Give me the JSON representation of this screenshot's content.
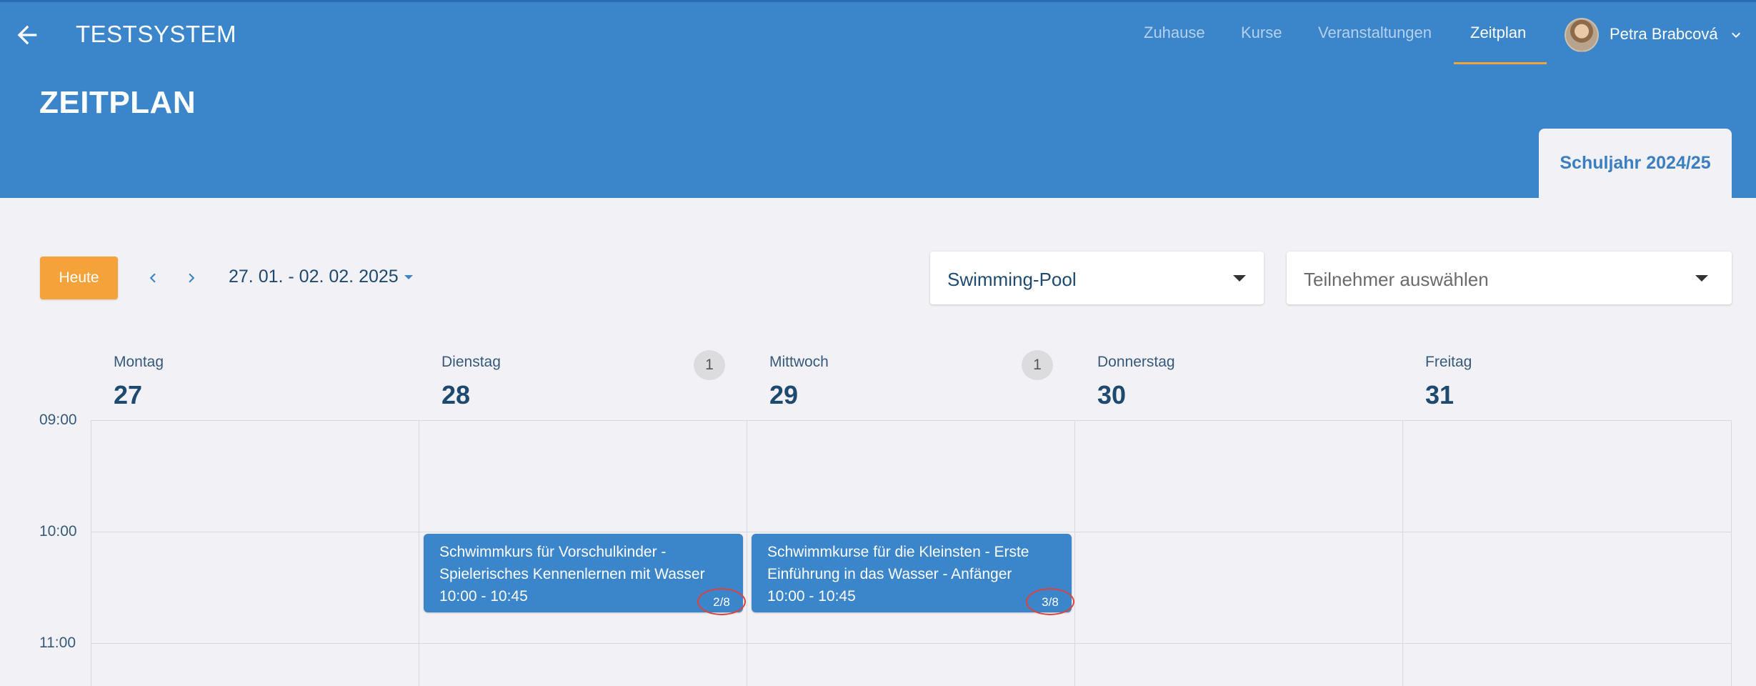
{
  "appbar": {
    "title": "TESTSYSTEM",
    "nav": [
      {
        "label": "Zuhause",
        "active": false
      },
      {
        "label": "Kurse",
        "active": false
      },
      {
        "label": "Veranstaltungen",
        "active": false
      },
      {
        "label": "Zeitplan",
        "active": true
      }
    ],
    "user": {
      "name": "Petra Brabcová"
    }
  },
  "header": {
    "page_title": "ZEITPLAN",
    "year_tab": "Schuljahr 2024/25"
  },
  "toolbar": {
    "today_label": "Heute",
    "date_range": "27. 01. - 02. 02. 2025",
    "location_select": "Swimming-Pool",
    "participant_placeholder": "Teilnehmer auswählen"
  },
  "calendar": {
    "days": [
      {
        "name": "Montag",
        "number": "27",
        "badge": ""
      },
      {
        "name": "Dienstag",
        "number": "28",
        "badge": "1"
      },
      {
        "name": "Mittwoch",
        "number": "29",
        "badge": "1"
      },
      {
        "name": "Donnerstag",
        "number": "30",
        "badge": ""
      },
      {
        "name": "Freitag",
        "number": "31",
        "badge": ""
      }
    ],
    "times": [
      "09:00",
      "10:00",
      "11:00"
    ],
    "events": [
      {
        "title_line1": "Schwimmkurs für Vorschulkinder -",
        "title_line2": "Spielerisches Kennenlernen mit Wasser",
        "time": "10:00 - 10:45",
        "count": "2/8"
      },
      {
        "title_line1": "Schwimmkurse für die Kleinsten - Erste",
        "title_line2": "Einführung in das Wasser - Anfänger",
        "time": "10:00 - 10:45",
        "count": "3/8"
      }
    ]
  },
  "colors": {
    "primary": "#3b85cb",
    "accent": "#f3a33a",
    "highlight_ring": "#e0413a"
  }
}
